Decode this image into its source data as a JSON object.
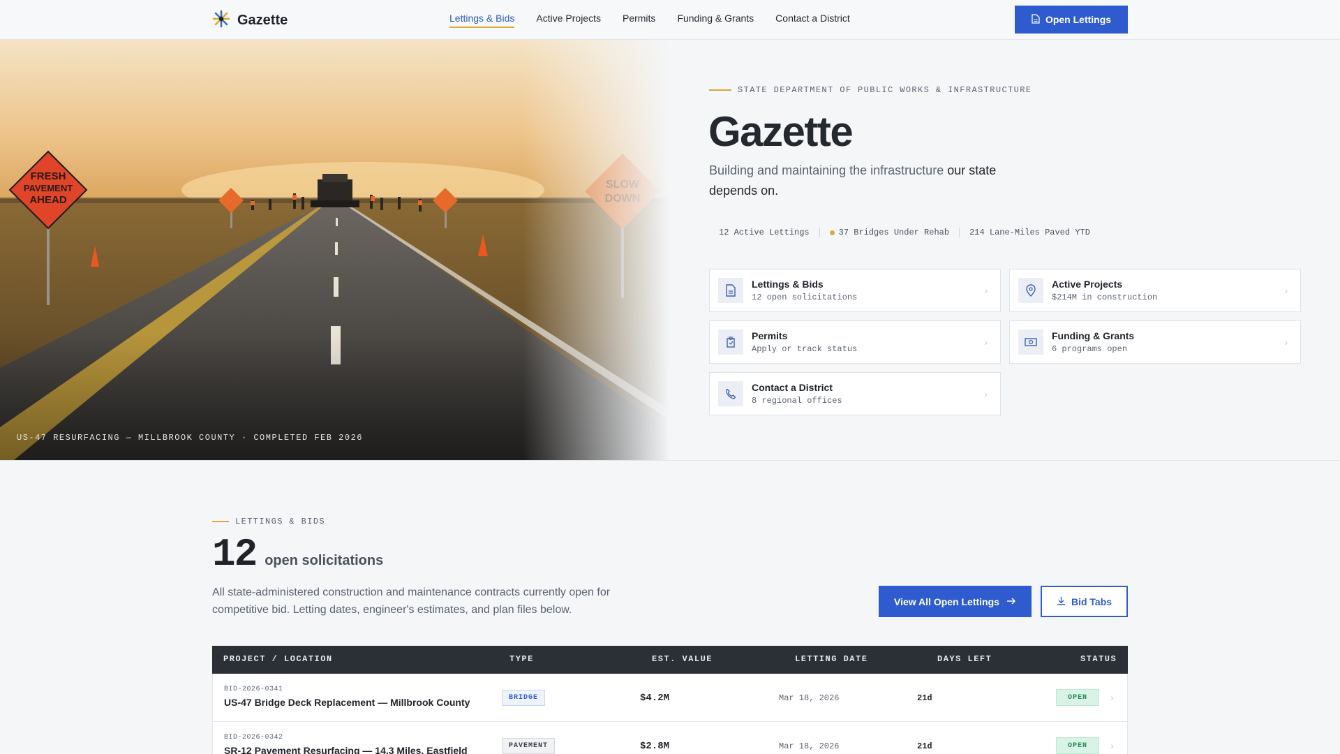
{
  "header": {
    "brand": "Gazette",
    "nav": [
      "Lettings & Bids",
      "Active Projects",
      "Permits",
      "Funding & Grants",
      "Contact a District"
    ],
    "cta": "Open Lettings"
  },
  "hero": {
    "caption": "US-47 RESURFACING — MILLBROOK COUNTY · COMPLETED FEB 2026",
    "sign_left": "FRESH PAVEMENT AHEAD",
    "sign_right": "SLOW DOWN",
    "eyebrow": "STATE DEPARTMENT OF PUBLIC WORKS & INFRASTRUCTURE",
    "title": "Gazette",
    "subtitle_pre": "Building and maintaining the infrastructure ",
    "subtitle_emph": "our state depends on.",
    "stats": [
      "12 Active Lettings",
      "37 Bridges Under Rehab",
      "214 Lane-Miles Paved YTD"
    ]
  },
  "quick_links": [
    {
      "title": "Lettings & Bids",
      "sub": "12 open solicitations",
      "icon": "document-icon"
    },
    {
      "title": "Active Projects",
      "sub": "$214M in construction",
      "icon": "map-pin-icon"
    },
    {
      "title": "Permits",
      "sub": "Apply or track status",
      "icon": "clipboard-icon"
    },
    {
      "title": "Funding & Grants",
      "sub": "6 programs open",
      "icon": "money-icon"
    },
    {
      "title": "Contact a District",
      "sub": "8 regional offices",
      "icon": "phone-icon"
    }
  ],
  "lettings": {
    "eyebrow": "LETTINGS & BIDS",
    "count": "12",
    "count_label": "open solicitations",
    "description": "All state-administered construction and maintenance contracts currently open for competitive bid. Letting dates, engineer's estimates, and plan files below.",
    "view_all": "View All Open Lettings",
    "bid_tabs": "Bid Tabs",
    "columns": [
      "PROJECT / LOCATION",
      "TYPE",
      "EST. VALUE",
      "LETTING DATE",
      "DAYS LEFT",
      "STATUS"
    ],
    "rows": [
      {
        "id": "BID-2026-0341",
        "name": "US-47 Bridge Deck Replacement — Millbrook County",
        "type": "BRIDGE",
        "value": "$4.2M",
        "date": "Mar 18, 2026",
        "days": "21d",
        "status": "OPEN"
      },
      {
        "id": "BID-2026-0342",
        "name": "SR-12 Pavement Resurfacing — 14.3 Miles, Eastfield",
        "type": "PAVEMENT",
        "value": "$2.8M",
        "date": "Mar 18, 2026",
        "days": "21d",
        "status": "OPEN"
      }
    ]
  },
  "colors": {
    "accent": "#2e5ccf",
    "gold": "#d8a93b",
    "dark": "#2b2f36",
    "open": "#1f8a55"
  }
}
